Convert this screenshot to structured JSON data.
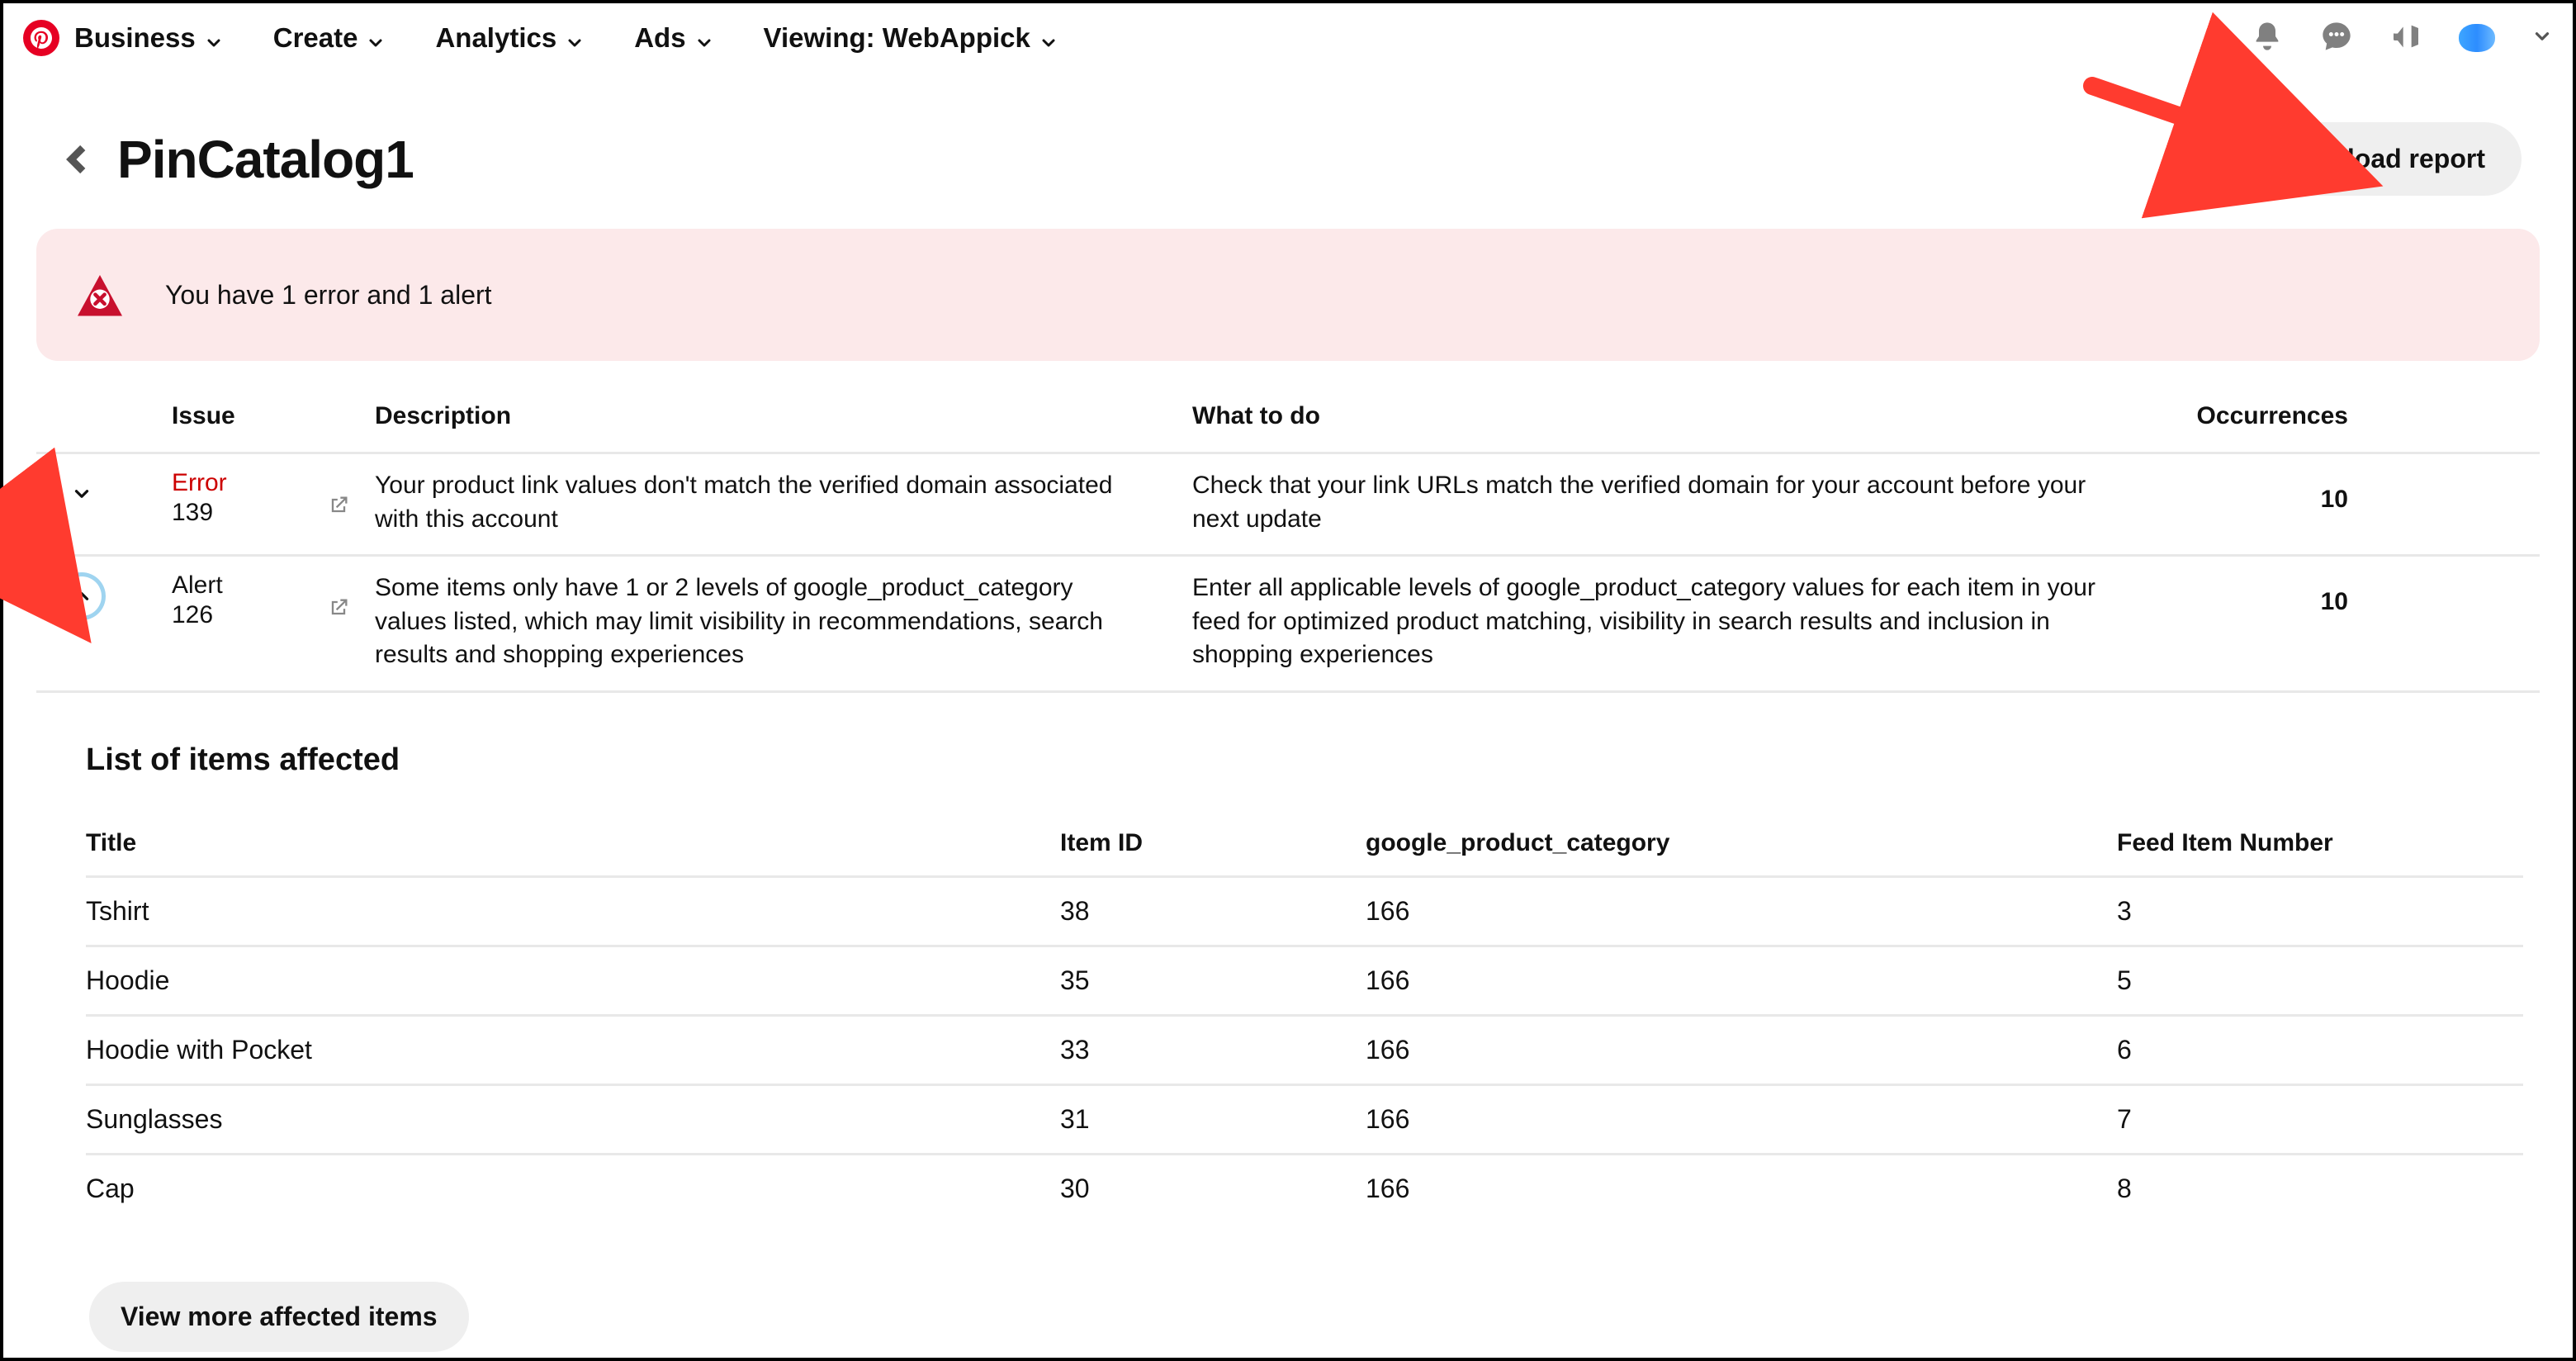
{
  "nav": {
    "items": [
      "Business",
      "Create",
      "Analytics",
      "Ads",
      "Viewing: WebAppick"
    ]
  },
  "page": {
    "title": "PinCatalog1",
    "download_button": "Download report",
    "banner_text": "You have 1 error and 1 alert"
  },
  "issues": {
    "headers": {
      "issue": "Issue",
      "description": "Description",
      "whattodo": "What to do",
      "occurrences": "Occurrences"
    },
    "rows": [
      {
        "type": "Error",
        "code": "139",
        "description": "Your product link values don't match the verified domain associated with this account",
        "whattodo": "Check that your link URLs match the verified domain for your account before your next update",
        "occurrences": "10",
        "expanded": false
      },
      {
        "type": "Alert",
        "code": "126",
        "description": "Some items only have 1 or 2 levels of google_product_category values listed, which may limit visibility in recommendations, search results and shopping experiences",
        "whattodo": "Enter all applicable levels of google_product_category values for each item in your feed for optimized product matching, visibility in search results and inclusion in shopping experiences",
        "occurrences": "10",
        "expanded": true
      }
    ]
  },
  "affected": {
    "title": "List of items affected",
    "headers": {
      "title": "Title",
      "item_id": "Item ID",
      "gpc": "google_product_category",
      "feed": "Feed Item Number"
    },
    "rows": [
      {
        "title": "Tshirt",
        "item_id": "38",
        "gpc": "166",
        "feed": "3"
      },
      {
        "title": "Hoodie",
        "item_id": "35",
        "gpc": "166",
        "feed": "5"
      },
      {
        "title": "Hoodie with Pocket",
        "item_id": "33",
        "gpc": "166",
        "feed": "6"
      },
      {
        "title": "Sunglasses",
        "item_id": "31",
        "gpc": "166",
        "feed": "7"
      },
      {
        "title": "Cap",
        "item_id": "30",
        "gpc": "166",
        "feed": "8"
      }
    ],
    "view_more": "View more affected items"
  }
}
